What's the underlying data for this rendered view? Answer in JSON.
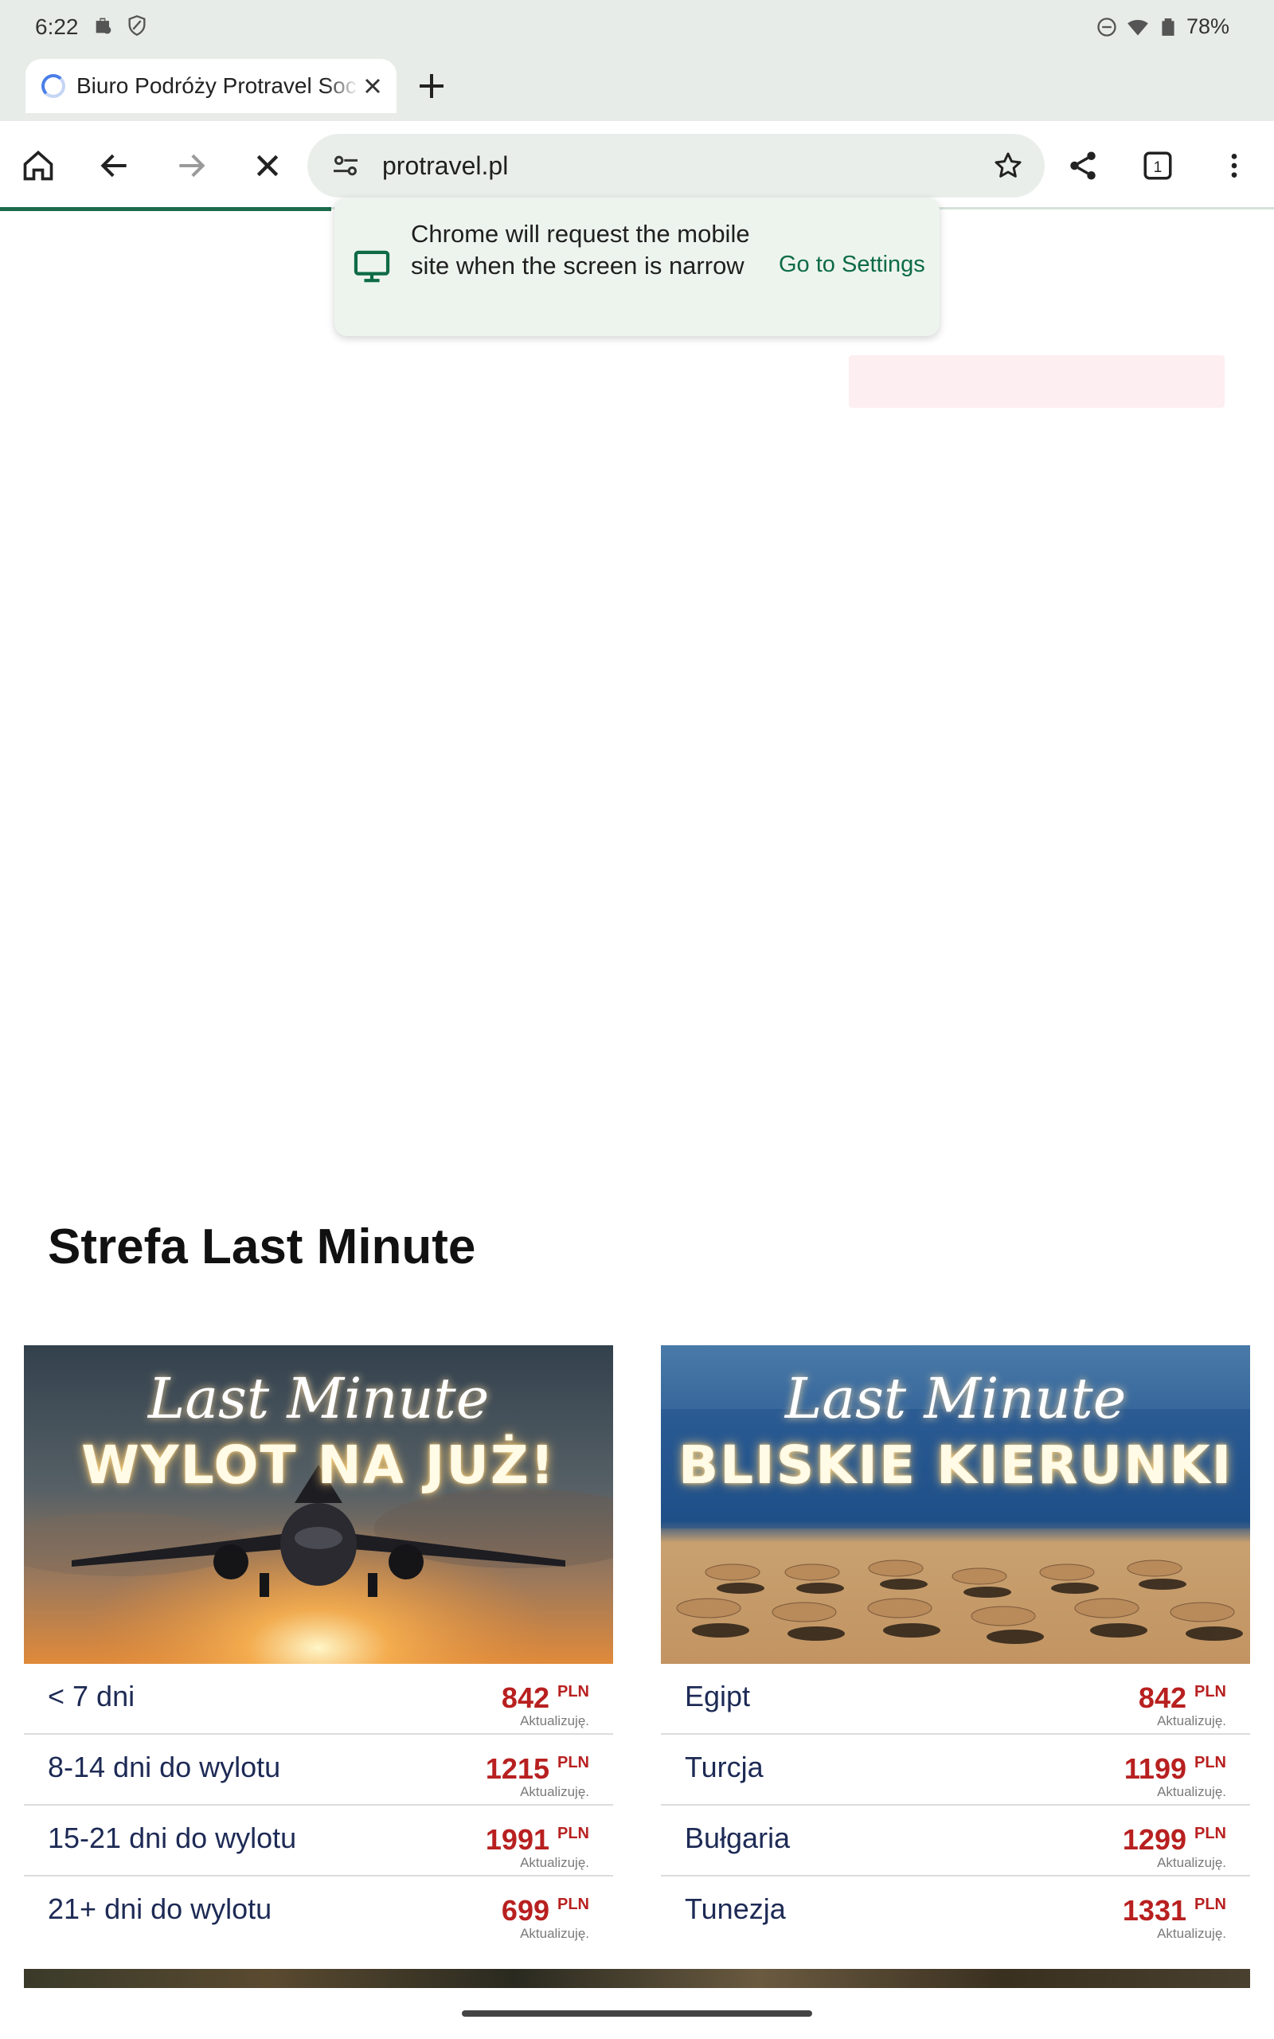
{
  "status_bar": {
    "time": "6:22",
    "battery": "78%"
  },
  "tab": {
    "title": "Biuro Podróży Protravel Sochaczew"
  },
  "toolbar": {
    "url": "protravel.pl"
  },
  "popup": {
    "message": "Chrome will request the mobile site when the screen is narrow",
    "link": "Go to Settings"
  },
  "section": {
    "title": "Strefa Last Minute"
  },
  "cards": [
    {
      "script": "Last Minute",
      "headline": "WYLOT NA JUŻ!",
      "rows": [
        {
          "label": "< 7 dni",
          "price": "842",
          "currency": "PLN",
          "sub": "Aktualizuję."
        },
        {
          "label": "8-14 dni do wylotu",
          "price": "1215",
          "currency": "PLN",
          "sub": "Aktualizuję."
        },
        {
          "label": "15-21 dni do wylotu",
          "price": "1991",
          "currency": "PLN",
          "sub": "Aktualizuję."
        },
        {
          "label": "21+ dni do wylotu",
          "price": "699",
          "currency": "PLN",
          "sub": "Aktualizuję."
        }
      ]
    },
    {
      "script": "Last Minute",
      "headline": "BLISKIE KIERUNKI",
      "rows": [
        {
          "label": "Egipt",
          "price": "842",
          "currency": "PLN",
          "sub": "Aktualizuję."
        },
        {
          "label": "Turcja",
          "price": "1199",
          "currency": "PLN",
          "sub": "Aktualizuję."
        },
        {
          "label": "Bułgaria",
          "price": "1299",
          "currency": "PLN",
          "sub": "Aktualizuję."
        },
        {
          "label": "Tunezja",
          "price": "1331",
          "currency": "PLN",
          "sub": "Aktualizuję."
        }
      ]
    }
  ],
  "colors": {
    "accent_green": "#0d6b45",
    "price_red": "#b82020",
    "label_navy": "#1d2a55"
  }
}
